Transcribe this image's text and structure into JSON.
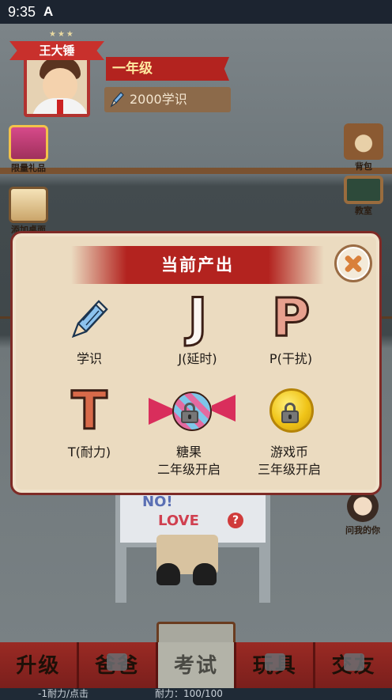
{
  "status_bar": {
    "time": "9:35",
    "app_icon": "A"
  },
  "profile": {
    "name": "王大锤",
    "grade": "一年级",
    "knowledge": "2000学识"
  },
  "side_buttons": {
    "gift": "限量礼品",
    "chest": "添加桌面",
    "bag": "背包",
    "classroom": "教室",
    "ask": "问我的你"
  },
  "desk": {
    "no_text": "NO!",
    "love_text": "LOVE",
    "question": "?"
  },
  "modal": {
    "title": "当前产出",
    "items": [
      {
        "label": "学识",
        "icon": "pencil-icon"
      },
      {
        "label": "J(延时)",
        "icon": "letter-j-icon",
        "glyph": "J"
      },
      {
        "label": "P(干扰)",
        "icon": "letter-p-icon",
        "glyph": "P"
      },
      {
        "label": "T(耐力)",
        "icon": "letter-t-icon",
        "glyph": "T"
      },
      {
        "label": "糖果",
        "sublabel": "二年级开启",
        "icon": "candy-icon"
      },
      {
        "label": "游戏币",
        "sublabel": "三年级开启",
        "icon": "coin-icon"
      }
    ]
  },
  "bottom_nav": {
    "tabs": [
      {
        "label": "升级",
        "locked": false
      },
      {
        "label": "爸爸",
        "locked": true
      },
      {
        "label": "考试",
        "locked": false
      },
      {
        "label": "玩具",
        "locked": true
      },
      {
        "label": "交友",
        "locked": true
      }
    ]
  },
  "footer": {
    "left": "-1耐力/点击",
    "right": "耐力：100/100"
  },
  "colors": {
    "ribbon_red": "#b3231f",
    "modal_bg": "#ebdbc0",
    "modal_border": "#7e2a26",
    "close_x": "#d9803a"
  }
}
